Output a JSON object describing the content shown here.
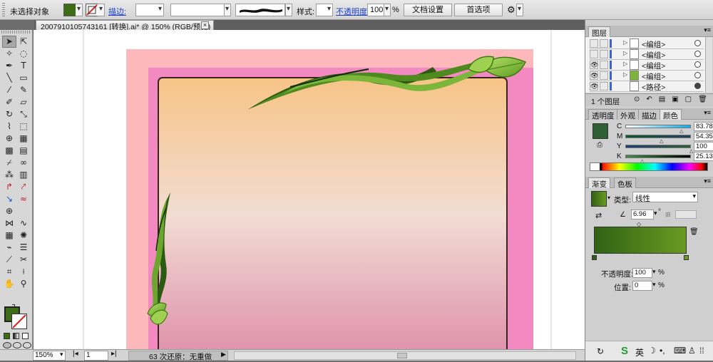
{
  "control_bar": {
    "selection_label": "未选择对象",
    "fill_color": "#3d6b16",
    "stroke_label": "描边:",
    "style_label": "样式:",
    "opacity_label": "不透明度:",
    "opacity_value": "100",
    "opacity_unit": "%",
    "doc_setup_button": "文档设置",
    "prefs_button": "首选项"
  },
  "document": {
    "tab_title": "2007910105743161 [转换].ai* @ 150% (RGB/预览)"
  },
  "status_bar": {
    "zoom": "150%",
    "page": "1",
    "history": "63 次还原：无重做"
  },
  "layers_panel": {
    "title": "图层",
    "rows": [
      {
        "name": "<编组>",
        "eye": ""
      },
      {
        "name": "<编组>",
        "eye": ""
      },
      {
        "name": "<编组>",
        "eye": "👁"
      },
      {
        "name": "<编组>",
        "eye": "👁"
      },
      {
        "name": "<路径>",
        "eye": "👁"
      }
    ],
    "footer": "1 个图层"
  },
  "color_panel": {
    "tabs": [
      "透明度",
      "外观",
      "描边",
      "颜色"
    ],
    "swatch": "#2e5e33",
    "channels": [
      {
        "label": "C",
        "value": "83.78",
        "gradient": "linear-gradient(90deg,#fff,#00aeef)"
      },
      {
        "label": "M",
        "value": "54.35",
        "gradient": "linear-gradient(90deg,#0c5a2c,#23405f)"
      },
      {
        "label": "Y",
        "value": "100",
        "gradient": "linear-gradient(90deg,#1d3b7a,#2e5e33)"
      },
      {
        "label": "K",
        "value": "25.13",
        "gradient": "linear-gradient(90deg,#3f8f47,#000)"
      }
    ]
  },
  "gradient_panel": {
    "tabs": [
      "渐变",
      "色板"
    ],
    "type_label": "类型:",
    "type_value": "线性",
    "angle_value": "6.96",
    "angle_unit": "°",
    "opacity_label": "不透明度:",
    "opacity_value": "100",
    "location_label": "位置:",
    "location_value": "0",
    "unit": "%",
    "start_color": "#2f6314",
    "end_color": "#6a9a22"
  },
  "taskbar": {
    "ime_label": "英"
  }
}
